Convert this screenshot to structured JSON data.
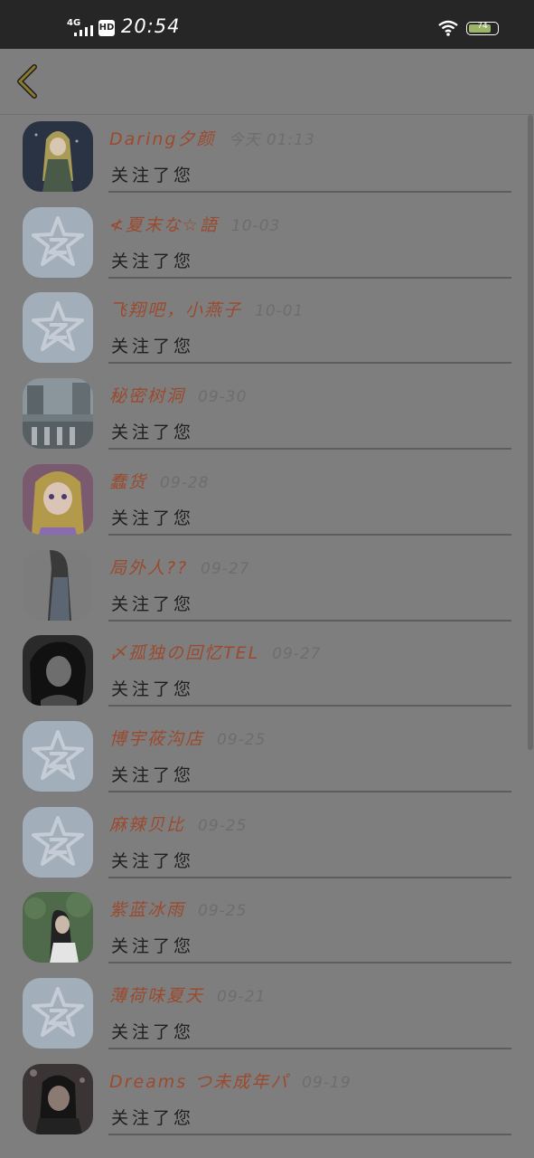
{
  "status_bar": {
    "network": "4G",
    "hd": "HD",
    "time": "20:54",
    "battery": "74"
  },
  "list": {
    "items": [
      {
        "name": "Daring夕颜",
        "time": "今天 01:13",
        "action": "关注了您",
        "avatar": "anime-girl-avatar"
      },
      {
        "name": "≮夏末な☆語",
        "time": "10-03",
        "action": "关注了您",
        "avatar": "default-qzone-avatar"
      },
      {
        "name": "飞翔吧，小燕子",
        "time": "10-01",
        "action": "关注了您",
        "avatar": "default-qzone-avatar"
      },
      {
        "name": "秘密树洞",
        "time": "09-30",
        "action": "关注了您",
        "avatar": "street-photo-avatar"
      },
      {
        "name": "蠢货",
        "time": "09-28",
        "action": "关注了您",
        "avatar": "anime-blonde-avatar"
      },
      {
        "name": "局外人??",
        "time": "09-27",
        "action": "关注了您",
        "avatar": "girl-photo-avatar"
      },
      {
        "name": "〆孤独の回忆TEL",
        "time": "09-27",
        "action": "关注了您",
        "avatar": "bw-girl-avatar"
      },
      {
        "name": "博宇莜沟店",
        "time": "09-25",
        "action": "关注了您",
        "avatar": "default-qzone-avatar"
      },
      {
        "name": "麻辣贝比",
        "time": "09-25",
        "action": "关注了您",
        "avatar": "default-qzone-avatar"
      },
      {
        "name": "紫蓝冰雨",
        "time": "09-25",
        "action": "关注了您",
        "avatar": "girl-nature-avatar"
      },
      {
        "name": "薄荷味夏天",
        "time": "09-21",
        "action": "关注了您",
        "avatar": "default-qzone-avatar"
      },
      {
        "name": "Dreams つ未成年パ",
        "time": "09-19",
        "action": "关注了您",
        "avatar": "dark-photo-avatar"
      }
    ]
  }
}
